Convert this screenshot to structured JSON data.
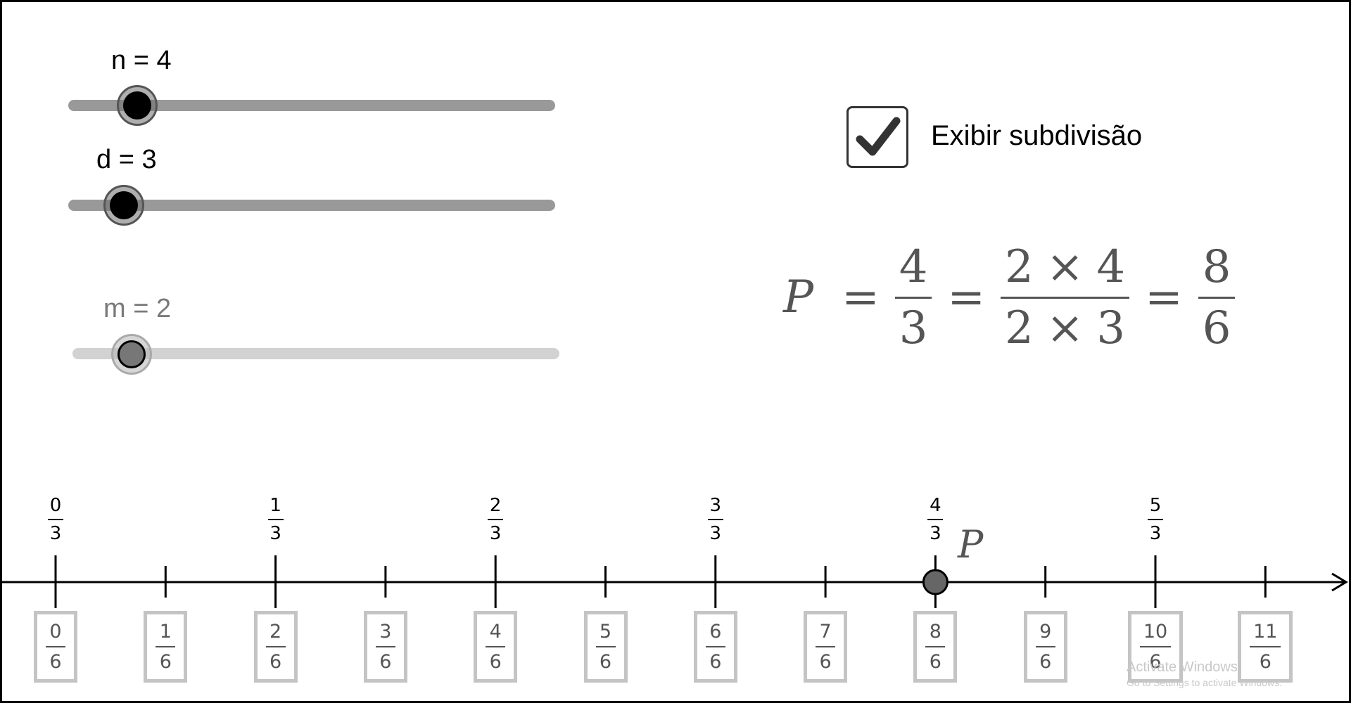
{
  "sliders": [
    {
      "label": "n = 4",
      "value": 4,
      "enabled": true
    },
    {
      "label": "d = 3",
      "value": 3,
      "enabled": true
    },
    {
      "label": "m = 2",
      "value": 2,
      "enabled": false
    }
  ],
  "checkbox": {
    "label": "Exibir subdivisão",
    "checked": true
  },
  "formula": {
    "var": "P",
    "eq": "=",
    "times": "×",
    "f1": {
      "num": "4",
      "den": "3"
    },
    "f2": {
      "num_a": "2",
      "num_b": "4",
      "den_a": "2",
      "den_b": "3"
    },
    "f3": {
      "num": "8",
      "den": "6"
    }
  },
  "number_line": {
    "top_fractions": [
      {
        "num": "0",
        "den": "3"
      },
      {
        "num": "1",
        "den": "3"
      },
      {
        "num": "2",
        "den": "3"
      },
      {
        "num": "3",
        "den": "3"
      },
      {
        "num": "4",
        "den": "3"
      },
      {
        "num": "5",
        "den": "3"
      }
    ],
    "bottom_fractions": [
      {
        "num": "0",
        "den": "6"
      },
      {
        "num": "1",
        "den": "6"
      },
      {
        "num": "2",
        "den": "6"
      },
      {
        "num": "3",
        "den": "6"
      },
      {
        "num": "4",
        "den": "6"
      },
      {
        "num": "5",
        "den": "6"
      },
      {
        "num": "6",
        "den": "6"
      },
      {
        "num": "7",
        "den": "6"
      },
      {
        "num": "8",
        "den": "6"
      },
      {
        "num": "9",
        "den": "6"
      },
      {
        "num": "10",
        "den": "6"
      },
      {
        "num": "11",
        "den": "6"
      }
    ],
    "point_label": "P",
    "point_index": 8
  },
  "watermark": {
    "line1": "Activate Windows",
    "line2": "Go to Settings to activate Windows."
  }
}
